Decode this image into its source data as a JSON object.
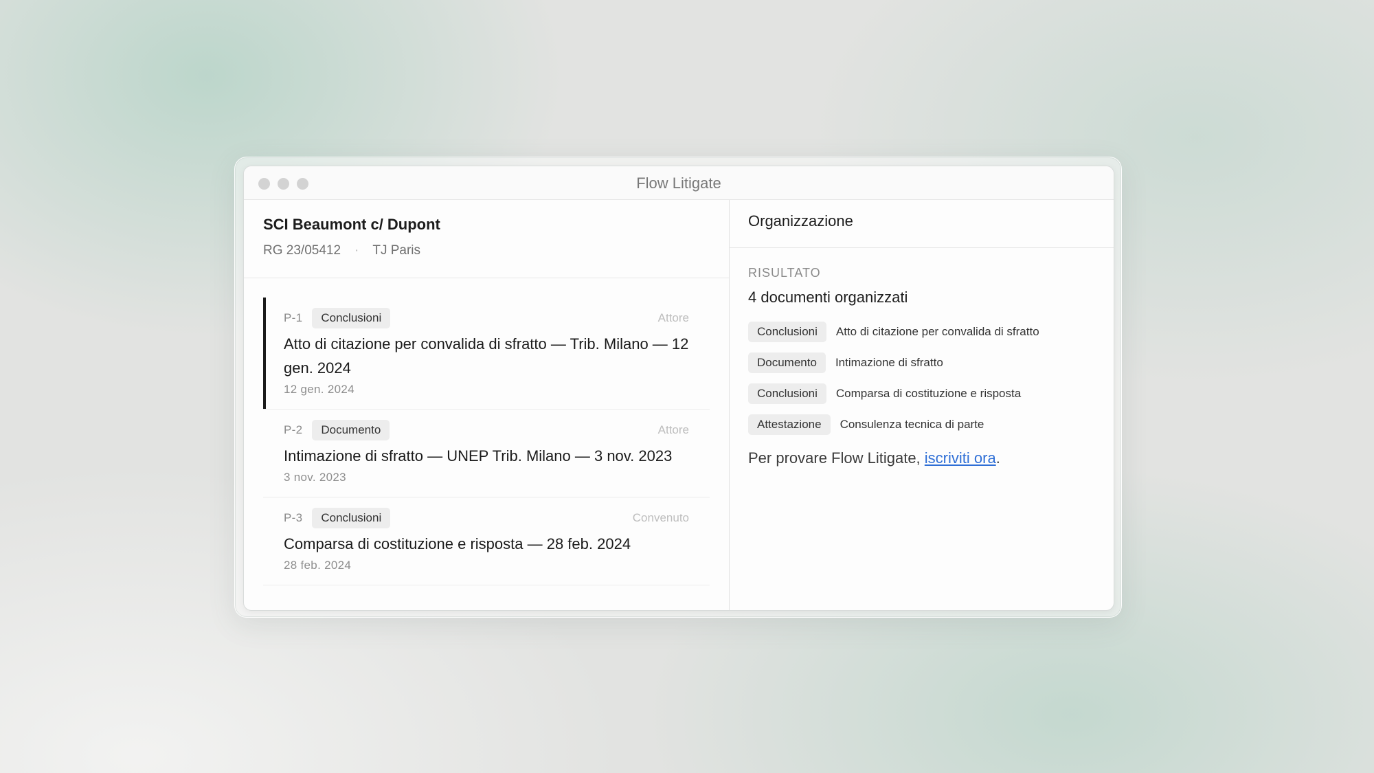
{
  "window": {
    "title": "Flow Litigate"
  },
  "case": {
    "title": "SCI Beaumont c/ Dupont",
    "number": "RG 23/05412",
    "separator": "·",
    "court": "TJ Paris"
  },
  "documents": [
    {
      "id": "P-1",
      "tag": "Conclusioni",
      "party": "Attore",
      "title": "Atto di citazione per convalida di sfratto — Trib. Milano — 12 gen. 2024",
      "date": "12 gen. 2024"
    },
    {
      "id": "P-2",
      "tag": "Documento",
      "party": "Attore",
      "title": "Intimazione di sfratto — UNEP Trib. Milano — 3 nov. 2023",
      "date": "3 nov. 2023"
    },
    {
      "id": "P-3",
      "tag": "Conclusioni",
      "party": "Convenuto",
      "title": "Comparsa di costituzione e risposta — 28 feb. 2024",
      "date": "28 feb. 2024"
    }
  ],
  "panel": {
    "header": "Organizzazione",
    "section_label": "RISULTATO",
    "result_title": "4 documenti organizzati",
    "results": [
      {
        "tag": "Conclusioni",
        "text": "Atto di citazione per convalida di sfratto"
      },
      {
        "tag": "Documento",
        "text": "Intimazione di sfratto"
      },
      {
        "tag": "Conclusioni",
        "text": "Comparsa di costituzione e risposta"
      },
      {
        "tag": "Attestazione",
        "text": "Consulenza tecnica di parte"
      }
    ],
    "cta_prefix": "Per provare Flow Litigate, ",
    "cta_link": "iscriviti ora",
    "cta_suffix": "."
  },
  "colors": {
    "link": "#2f6fd6",
    "selected_bar": "#1a1a1a",
    "tag_bg": "#ededed"
  }
}
